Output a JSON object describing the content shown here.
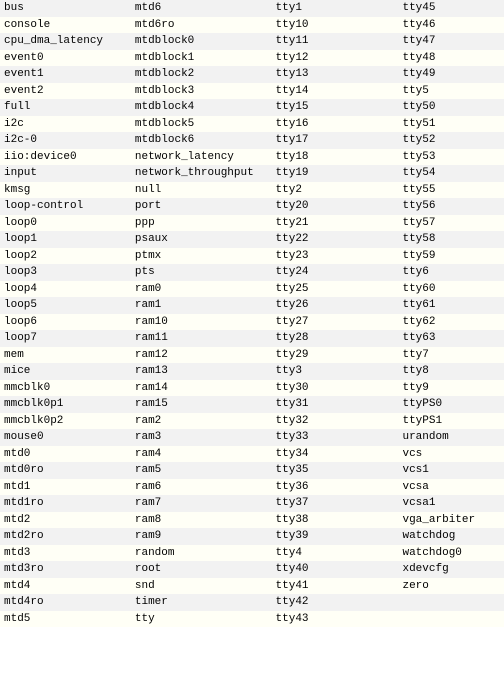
{
  "listing": {
    "columns": [
      [
        "bus",
        "console",
        "cpu_dma_latency",
        "event0",
        "event1",
        "event2",
        "full",
        "i2c",
        "i2c-0",
        "iio:device0",
        "input",
        "kmsg",
        "loop-control",
        "loop0",
        "loop1",
        "loop2",
        "loop3",
        "loop4",
        "loop5",
        "loop6",
        "loop7",
        "mem",
        "mice",
        "mmcblk0",
        "mmcblk0p1",
        "mmcblk0p2",
        "mouse0",
        "mtd0",
        "mtd0ro",
        "mtd1",
        "mtd1ro",
        "mtd2",
        "mtd2ro",
        "mtd3",
        "mtd3ro",
        "mtd4",
        "mtd4ro",
        "mtd5"
      ],
      [
        "mtd6",
        "mtd6ro",
        "mtdblock0",
        "mtdblock1",
        "mtdblock2",
        "mtdblock3",
        "mtdblock4",
        "mtdblock5",
        "mtdblock6",
        "network_latency",
        "network_throughput",
        "null",
        "port",
        "ppp",
        "psaux",
        "ptmx",
        "pts",
        "ram0",
        "ram1",
        "ram10",
        "ram11",
        "ram12",
        "ram13",
        "ram14",
        "ram15",
        "ram2",
        "ram3",
        "ram4",
        "ram5",
        "ram6",
        "ram7",
        "ram8",
        "ram9",
        "random",
        "root",
        "snd",
        "timer",
        "tty"
      ],
      [
        "tty1",
        "tty10",
        "tty11",
        "tty12",
        "tty13",
        "tty14",
        "tty15",
        "tty16",
        "tty17",
        "tty18",
        "tty19",
        "tty2",
        "tty20",
        "tty21",
        "tty22",
        "tty23",
        "tty24",
        "tty25",
        "tty26",
        "tty27",
        "tty28",
        "tty29",
        "tty3",
        "tty30",
        "tty31",
        "tty32",
        "tty33",
        "tty34",
        "tty35",
        "tty36",
        "tty37",
        "tty38",
        "tty39",
        "tty4",
        "tty40",
        "tty41",
        "tty42",
        "tty43"
      ],
      [
        "tty45",
        "tty46",
        "tty47",
        "tty48",
        "tty49",
        "tty5",
        "tty50",
        "tty51",
        "tty52",
        "tty53",
        "tty54",
        "tty55",
        "tty56",
        "tty57",
        "tty58",
        "tty59",
        "tty6",
        "tty60",
        "tty61",
        "tty62",
        "tty63",
        "tty7",
        "tty8",
        "tty9",
        "ttyPS0",
        "ttyPS1",
        "urandom",
        "vcs",
        "vcs1",
        "vcsa",
        "vcsa1",
        "vga_arbiter",
        "watchdog",
        "watchdog0",
        "xdevcfg",
        "zero",
        "",
        ""
      ]
    ]
  }
}
